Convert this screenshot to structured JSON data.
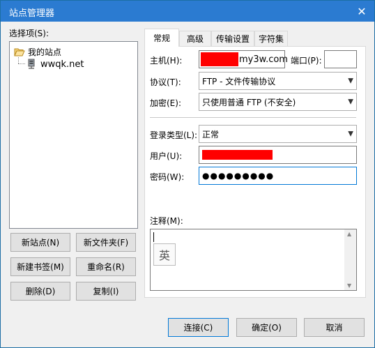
{
  "window": {
    "title": "站点管理器",
    "close_glyph": "✕"
  },
  "left": {
    "select_label": "选择项(S):",
    "tree": {
      "root_label": "我的站点",
      "site_label": "wwqk.net"
    },
    "buttons": {
      "new_site": "新站点(N)",
      "new_folder": "新文件夹(F)",
      "new_bookmark": "新建书签(M)",
      "rename": "重命名(R)",
      "delete": "删除(D)",
      "copy": "复制(I)"
    }
  },
  "tabs": [
    "常规",
    "高级",
    "传输设置",
    "字符集"
  ],
  "general": {
    "host_label": "主机(H):",
    "host_value_visible": "my3w.com",
    "port_label": "端口(P):",
    "port_value": "",
    "protocol_label": "协议(T):",
    "protocol_value": "FTP - 文件传输协议",
    "encryption_label": "加密(E):",
    "encryption_value": "只使用普通 FTP (不安全)",
    "logon_type_label": "登录类型(L):",
    "logon_type_value": "正常",
    "user_label": "用户(U):",
    "password_label": "密码(W):",
    "password_value": "●●●●●●●●●",
    "comments_label": "注释(M):",
    "ime_glyph": "英"
  },
  "footer": {
    "connect": "连接(C)",
    "ok": "确定(O)",
    "cancel": "取消"
  },
  "colors": {
    "titlebar": "#2b7bd1",
    "redaction": "#ff0000",
    "focus": "#0078d7"
  }
}
